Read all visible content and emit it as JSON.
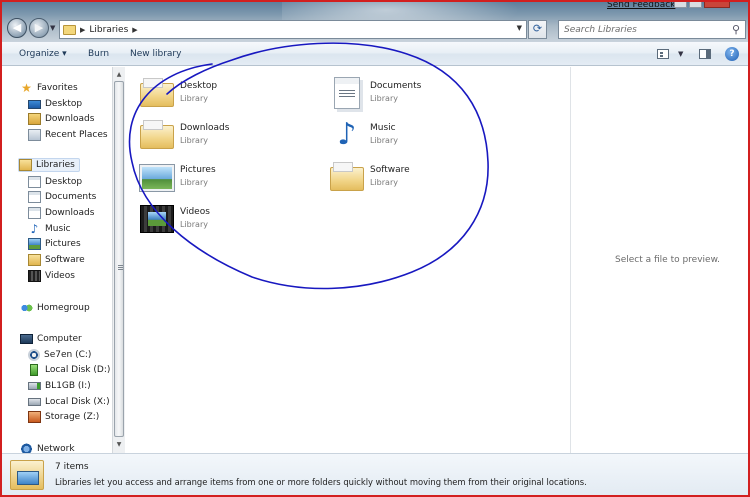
{
  "window": {
    "send_feedback": "Send Feedback"
  },
  "address_bar": {
    "breadcrumb": "Libraries"
  },
  "search": {
    "placeholder": "Search Libraries"
  },
  "toolbar": {
    "organize": "Organize ▾",
    "burn": "Burn",
    "new_library": "New library"
  },
  "nav": {
    "favorites": {
      "header": "Favorites",
      "items": [
        "Desktop",
        "Downloads",
        "Recent Places"
      ]
    },
    "libraries": {
      "header": "Libraries",
      "items": [
        "Desktop",
        "Documents",
        "Downloads",
        "Music",
        "Pictures",
        "Software",
        "Videos"
      ]
    },
    "homegroup": "Homegroup",
    "computer": {
      "header": "Computer",
      "drives": [
        "Se7en (C:)",
        "Local Disk (D:)",
        "BL1GB (I:)",
        "Local Disk (X:)",
        "Storage (Z:)"
      ]
    },
    "network": "Network"
  },
  "libraries": [
    {
      "name": "Desktop",
      "type": "Library",
      "icon": "folder-icon"
    },
    {
      "name": "Documents",
      "type": "Library",
      "icon": "documents-icon"
    },
    {
      "name": "Downloads",
      "type": "Library",
      "icon": "folder-icon"
    },
    {
      "name": "Music",
      "type": "Library",
      "icon": "music-note-icon"
    },
    {
      "name": "Pictures",
      "type": "Library",
      "icon": "pictures-icon"
    },
    {
      "name": "Software",
      "type": "Library",
      "icon": "folder-icon"
    },
    {
      "name": "Videos",
      "type": "Library",
      "icon": "video-icon"
    }
  ],
  "preview": {
    "message": "Select a file to preview."
  },
  "details": {
    "count": "7 items",
    "description": "Libraries let you access and arrange items from one or more folders quickly without moving them from their original locations."
  },
  "colors": {
    "annotation_frame": "#d21f1f",
    "annotation_circle": "#1818c0",
    "selected_nav_bg": "#e8f0fa"
  }
}
